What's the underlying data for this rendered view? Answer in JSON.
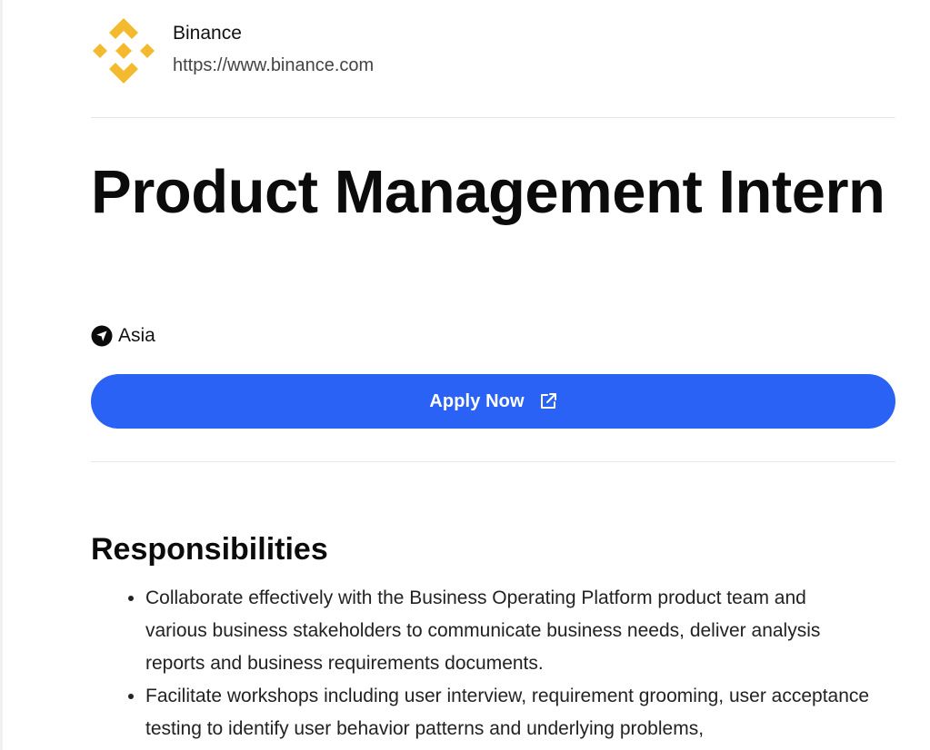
{
  "company": {
    "name": "Binance",
    "url": "https://www.binance.com",
    "logo_icon": "binance-logo-icon",
    "brand_color": "#F3BA2F"
  },
  "job": {
    "title": "Product Management Intern",
    "location": "Asia",
    "location_icon": "navigation-arrow-icon"
  },
  "apply": {
    "label": "Apply Now",
    "icon": "external-link-icon",
    "color": "#2A62F5"
  },
  "responsibilities": {
    "heading": "Responsibilities",
    "items": [
      "Collaborate effectively with the Business Operating Platform product team and various business stakeholders to communicate business needs, deliver analysis reports and business requirements documents.",
      "Facilitate workshops including user interview, requirement grooming, user acceptance testing to identify user behavior patterns and underlying problems,"
    ]
  }
}
